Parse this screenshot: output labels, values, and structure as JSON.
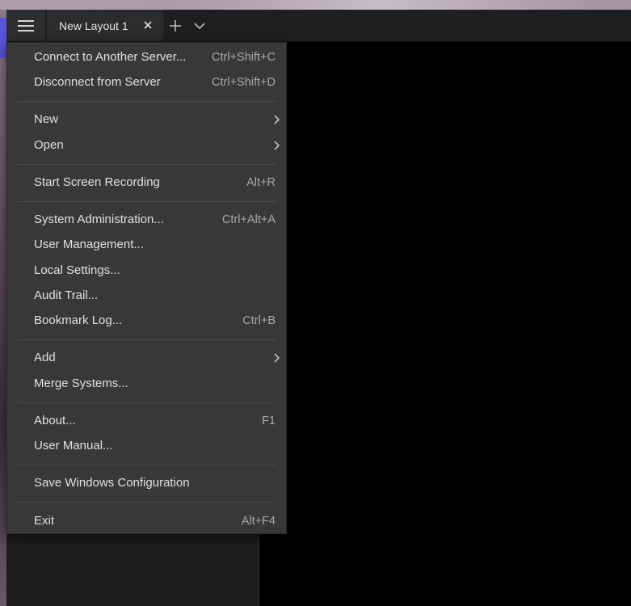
{
  "tabs": [
    {
      "label": "New Layout 1"
    }
  ],
  "menu": {
    "items": [
      {
        "label": "Connect to Another Server...",
        "shortcut": "Ctrl+Shift+C"
      },
      {
        "label": "Disconnect from Server",
        "shortcut": "Ctrl+Shift+D"
      },
      {
        "label": "New",
        "submenu": true
      },
      {
        "label": "Open",
        "submenu": true
      },
      {
        "label": "Start Screen Recording",
        "shortcut": "Alt+R"
      },
      {
        "label": "System Administration...",
        "shortcut": "Ctrl+Alt+A"
      },
      {
        "label": "User Management..."
      },
      {
        "label": "Local Settings..."
      },
      {
        "label": "Audit Trail..."
      },
      {
        "label": "Bookmark Log...",
        "shortcut": "Ctrl+B"
      },
      {
        "label": "Add",
        "submenu": true
      },
      {
        "label": "Merge Systems..."
      },
      {
        "label": "About...",
        "shortcut": "F1"
      },
      {
        "label": "User Manual..."
      },
      {
        "label": "Save Windows Configuration"
      },
      {
        "label": "Exit",
        "shortcut": "Alt+F4"
      }
    ]
  },
  "icons": {
    "main_menu": "hamburger-icon",
    "tab_close": "close-icon",
    "new_tab": "plus-icon",
    "tab_list": "chevron-down-icon",
    "submenu": "chevron-right-icon"
  },
  "colors": {
    "menu_bg": "#373839",
    "menu_text": "#e1e1e1",
    "shortcut_text": "#a8a9aa",
    "tabbar_bg": "#1e1f20",
    "desktop_accent": "#5a55d8"
  }
}
